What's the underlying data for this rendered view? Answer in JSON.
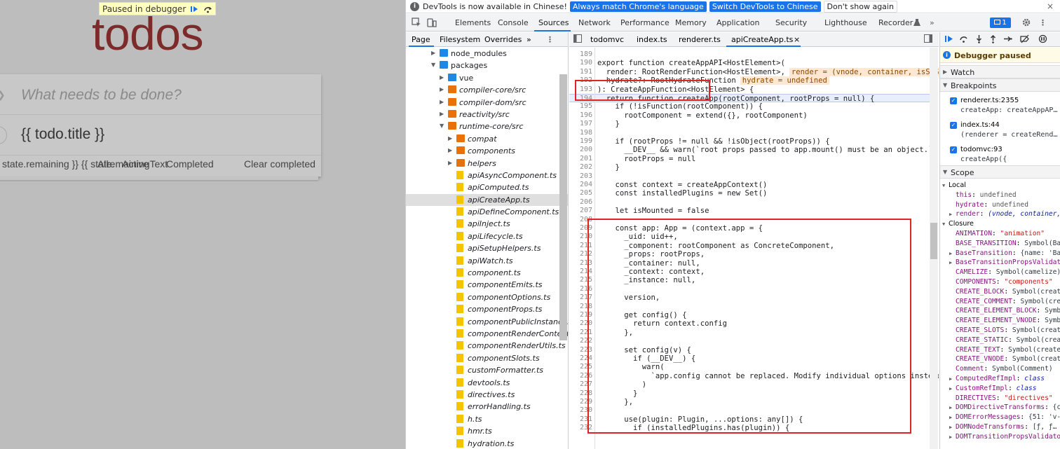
{
  "app": {
    "paused_label": "Paused in debugger",
    "title": "todos",
    "new_todo_placeholder": "What needs to be done?",
    "toggle_all": "❯",
    "todo_item_label": "{{ todo.title }}",
    "footer": {
      "remaining": "state.remaining }} {{ state.",
      "filter_all": "All",
      "filter_active": "Active",
      "remaining_text": "remainingText",
      "pluralize": "}}",
      "filter_completed": "Completed",
      "clear_completed": "Clear completed"
    }
  },
  "infobar": {
    "message": "DevTools is now available in Chinese!",
    "btn_match": "Always match Chrome's language",
    "btn_switch": "Switch DevTools to Chinese",
    "btn_dismiss": "Don't show again",
    "close": "×"
  },
  "tabs": {
    "elements": "Elements",
    "console": "Console",
    "sources": "Sources",
    "network": "Network",
    "performance": "Performance",
    "memory": "Memory",
    "application": "Application",
    "security": "Security",
    "lighthouse": "Lighthouse",
    "recorder": "Recorder",
    "issues_count": "1"
  },
  "navigator": {
    "tabs": [
      "Page",
      "Filesystem",
      "Overrides",
      "»"
    ],
    "items": [
      {
        "label": "node_modules",
        "type": "folder-blue",
        "arrow": "▶",
        "indent": 1
      },
      {
        "label": "packages",
        "type": "folder-blue",
        "arrow": "▼",
        "indent": 1
      },
      {
        "label": "vue",
        "type": "folder-blue",
        "arrow": "▶",
        "indent": 2
      },
      {
        "label": "compiler-core/src",
        "type": "folder-orange",
        "arrow": "▶",
        "indent": 2
      },
      {
        "label": "compiler-dom/src",
        "type": "folder-orange",
        "arrow": "▶",
        "indent": 2
      },
      {
        "label": "reactivity/src",
        "type": "folder-orange",
        "arrow": "▶",
        "indent": 2
      },
      {
        "label": "runtime-core/src",
        "type": "folder-orange",
        "arrow": "▼",
        "indent": 2
      },
      {
        "label": "compat",
        "type": "folder-orange",
        "arrow": "▶",
        "indent": 3
      },
      {
        "label": "components",
        "type": "folder-orange",
        "arrow": "▶",
        "indent": 3
      },
      {
        "label": "helpers",
        "type": "folder-orange",
        "arrow": "▶",
        "indent": 3
      },
      {
        "label": "apiAsyncComponent.ts",
        "type": "file",
        "arrow": "",
        "indent": 3
      },
      {
        "label": "apiComputed.ts",
        "type": "file",
        "arrow": "",
        "indent": 3
      },
      {
        "label": "apiCreateApp.ts",
        "type": "file",
        "arrow": "",
        "indent": 3,
        "selected": true
      },
      {
        "label": "apiDefineComponent.ts",
        "type": "file",
        "arrow": "",
        "indent": 3
      },
      {
        "label": "apiInject.ts",
        "type": "file",
        "arrow": "",
        "indent": 3
      },
      {
        "label": "apiLifecycle.ts",
        "type": "file",
        "arrow": "",
        "indent": 3
      },
      {
        "label": "apiSetupHelpers.ts",
        "type": "file",
        "arrow": "",
        "indent": 3
      },
      {
        "label": "apiWatch.ts",
        "type": "file",
        "arrow": "",
        "indent": 3
      },
      {
        "label": "component.ts",
        "type": "file",
        "arrow": "",
        "indent": 3
      },
      {
        "label": "componentEmits.ts",
        "type": "file",
        "arrow": "",
        "indent": 3
      },
      {
        "label": "componentOptions.ts",
        "type": "file",
        "arrow": "",
        "indent": 3
      },
      {
        "label": "componentProps.ts",
        "type": "file",
        "arrow": "",
        "indent": 3
      },
      {
        "label": "componentPublicInstance.ts",
        "type": "file",
        "arrow": "",
        "indent": 3
      },
      {
        "label": "componentRenderContext.ts",
        "type": "file",
        "arrow": "",
        "indent": 3
      },
      {
        "label": "componentRenderUtils.ts",
        "type": "file",
        "arrow": "",
        "indent": 3
      },
      {
        "label": "componentSlots.ts",
        "type": "file",
        "arrow": "",
        "indent": 3
      },
      {
        "label": "customFormatter.ts",
        "type": "file",
        "arrow": "",
        "indent": 3
      },
      {
        "label": "devtools.ts",
        "type": "file",
        "arrow": "",
        "indent": 3
      },
      {
        "label": "directives.ts",
        "type": "file",
        "arrow": "",
        "indent": 3
      },
      {
        "label": "errorHandling.ts",
        "type": "file",
        "arrow": "",
        "indent": 3
      },
      {
        "label": "h.ts",
        "type": "file",
        "arrow": "",
        "indent": 3
      },
      {
        "label": "hmr.ts",
        "type": "file",
        "arrow": "",
        "indent": 3
      },
      {
        "label": "hydration.ts",
        "type": "file",
        "arrow": "",
        "indent": 3
      }
    ]
  },
  "editor": {
    "tabs": [
      "todomvc",
      "index.ts",
      "renderer.ts",
      "apiCreateApp.ts"
    ],
    "tab_close": "×",
    "lines": [
      {
        "n": "189",
        "text": ""
      },
      {
        "n": "190",
        "text": "export function createAppAPI<HostElement>("
      },
      {
        "n": "191",
        "text": "  render: RootRenderFunction<HostElement>,",
        "inline": "render = (vnode, container, isSVG) =>"
      },
      {
        "n": "192",
        "text": "  hydrate?: RootHydrateFunction",
        "inline": "hydrate = undefined"
      },
      {
        "n": "193",
        "text": "): CreateAppFunction<HostElement> {"
      },
      {
        "n": "194",
        "text": "  return function createApp(rootComponent, rootProps = null) {",
        "hl": true
      },
      {
        "n": "195",
        "text": "    if (!isFunction(rootComponent)) {"
      },
      {
        "n": "196",
        "text": "      rootComponent = extend({}, rootComponent)"
      },
      {
        "n": "197",
        "text": "    }"
      },
      {
        "n": "198",
        "text": ""
      },
      {
        "n": "199",
        "text": "    if (rootProps != null && !isObject(rootProps)) {"
      },
      {
        "n": "200",
        "text": "      __DEV__ && warn(`root props passed to app.mount() must be an object.`)"
      },
      {
        "n": "201",
        "text": "      rootProps = null"
      },
      {
        "n": "202",
        "text": "    }"
      },
      {
        "n": "203",
        "text": ""
      },
      {
        "n": "204",
        "text": "    const context = createAppContext()"
      },
      {
        "n": "205",
        "text": "    const installedPlugins = new Set()"
      },
      {
        "n": "206",
        "text": ""
      },
      {
        "n": "207",
        "text": "    let isMounted = false"
      },
      {
        "n": "208",
        "text": ""
      },
      {
        "n": "209",
        "text": "    const app: App = (context.app = {"
      },
      {
        "n": "210",
        "text": "      _uid: uid++,"
      },
      {
        "n": "211",
        "text": "      _component: rootComponent as ConcreteComponent,"
      },
      {
        "n": "212",
        "text": "      _props: rootProps,"
      },
      {
        "n": "213",
        "text": "      _container: null,"
      },
      {
        "n": "214",
        "text": "      _context: context,"
      },
      {
        "n": "215",
        "text": "      _instance: null,"
      },
      {
        "n": "216",
        "text": ""
      },
      {
        "n": "217",
        "text": "      version,"
      },
      {
        "n": "218",
        "text": ""
      },
      {
        "n": "219",
        "text": "      get config() {"
      },
      {
        "n": "220",
        "text": "        return context.config"
      },
      {
        "n": "221",
        "text": "      },"
      },
      {
        "n": "222",
        "text": ""
      },
      {
        "n": "223",
        "text": "      set config(v) {"
      },
      {
        "n": "224",
        "text": "        if (__DEV__) {"
      },
      {
        "n": "225",
        "text": "          warn("
      },
      {
        "n": "226",
        "text": "            `app.config cannot be replaced. Modify individual options instead.`"
      },
      {
        "n": "227",
        "text": "          )"
      },
      {
        "n": "228",
        "text": "        }"
      },
      {
        "n": "229",
        "text": "      },"
      },
      {
        "n": "230",
        "text": ""
      },
      {
        "n": "231",
        "text": "      use(plugin: Plugin, ...options: any[]) {"
      },
      {
        "n": "232",
        "text": "        if (installedPlugins.has(plugin)) {"
      }
    ]
  },
  "debugger": {
    "paused": "Debugger paused",
    "watch": "Watch",
    "breakpoints_title": "Breakpoints",
    "breakpoints": [
      {
        "file": "renderer.ts:2355",
        "code": "createApp: createAppAP…"
      },
      {
        "file": "index.ts:44",
        "code": "(renderer = createRend…"
      },
      {
        "file": "todomvc:93",
        "code": "createApp({"
      }
    ],
    "scope_title": "Scope",
    "scope": [
      {
        "indent": 0,
        "arrow": "▼",
        "key": "Local",
        "sep": "",
        "val": "",
        "kind": "head"
      },
      {
        "indent": 1,
        "arrow": "",
        "key": "this",
        "sep": ": ",
        "val": "undefined",
        "kind": "g"
      },
      {
        "indent": 1,
        "arrow": "",
        "key": "hydrate",
        "sep": ": ",
        "val": "undefined",
        "kind": "g"
      },
      {
        "indent": 1,
        "arrow": "▶",
        "key": "render",
        "sep": ": ",
        "val": "(vnode, container, …",
        "kind": "i"
      },
      {
        "indent": 0,
        "arrow": "▼",
        "key": "Closure",
        "sep": "",
        "val": "",
        "kind": "head"
      },
      {
        "indent": 1,
        "arrow": "",
        "key": "ANIMATION",
        "sep": ": ",
        "val": "\"animation\"",
        "kind": "s"
      },
      {
        "indent": 1,
        "arrow": "",
        "key": "BASE_TRANSITION",
        "sep": ": ",
        "val": "Symbol(Bas…",
        "kind": "o"
      },
      {
        "indent": 1,
        "arrow": "▶",
        "key": "BaseTransition",
        "sep": ": ",
        "val": "{name: 'Bas…",
        "kind": "o"
      },
      {
        "indent": 1,
        "arrow": "▶",
        "key": "BaseTransitionPropsValidato…",
        "sep": "",
        "val": "",
        "kind": "o"
      },
      {
        "indent": 1,
        "arrow": "",
        "key": "CAMELIZE",
        "sep": ": ",
        "val": "Symbol(camelize)",
        "kind": "o"
      },
      {
        "indent": 1,
        "arrow": "",
        "key": "COMPONENTS",
        "sep": ": ",
        "val": "\"components\"",
        "kind": "s"
      },
      {
        "indent": 1,
        "arrow": "",
        "key": "CREATE_BLOCK",
        "sep": ": ",
        "val": "Symbol(create…",
        "kind": "o"
      },
      {
        "indent": 1,
        "arrow": "",
        "key": "CREATE_COMMENT",
        "sep": ": ",
        "val": "Symbol(crea…",
        "kind": "o"
      },
      {
        "indent": 1,
        "arrow": "",
        "key": "CREATE_ELEMENT_BLOCK",
        "sep": ": ",
        "val": "Symbo…",
        "kind": "o"
      },
      {
        "indent": 1,
        "arrow": "",
        "key": "CREATE_ELEMENT_VNODE",
        "sep": ": ",
        "val": "Symbo…",
        "kind": "o"
      },
      {
        "indent": 1,
        "arrow": "",
        "key": "CREATE_SLOTS",
        "sep": ": ",
        "val": "Symbol(create…",
        "kind": "o"
      },
      {
        "indent": 1,
        "arrow": "",
        "key": "CREATE_STATIC",
        "sep": ": ",
        "val": "Symbol(creat…",
        "kind": "o"
      },
      {
        "indent": 1,
        "arrow": "",
        "key": "CREATE_TEXT",
        "sep": ": ",
        "val": "Symbol(create…",
        "kind": "o"
      },
      {
        "indent": 1,
        "arrow": "",
        "key": "CREATE_VNODE",
        "sep": ": ",
        "val": "Symbol(create…",
        "kind": "o"
      },
      {
        "indent": 1,
        "arrow": "",
        "key": "Comment",
        "sep": ": ",
        "val": "Symbol(Comment)",
        "kind": "o"
      },
      {
        "indent": 1,
        "arrow": "▶",
        "key": "ComputedRefImpl",
        "sep": ": ",
        "val": "class",
        "kind": "i"
      },
      {
        "indent": 1,
        "arrow": "▶",
        "key": "CustomRefImpl",
        "sep": ": ",
        "val": "class",
        "kind": "i"
      },
      {
        "indent": 1,
        "arrow": "",
        "key": "DIRECTIVES",
        "sep": ": ",
        "val": "\"directives\"",
        "kind": "s"
      },
      {
        "indent": 1,
        "arrow": "▶",
        "key": "DOMDirectiveTransforms",
        "sep": ": ",
        "val": "{cl…",
        "kind": "o"
      },
      {
        "indent": 1,
        "arrow": "▶",
        "key": "DOMErrorMessages",
        "sep": ": ",
        "val": "{51: 'v-h…",
        "kind": "o"
      },
      {
        "indent": 1,
        "arrow": "▶",
        "key": "DOMNodeTransforms",
        "sep": ": ",
        "val": "[ƒ, ƒ…",
        "kind": "o"
      },
      {
        "indent": 1,
        "arrow": "▶",
        "key": "DOMTransitionPropsValidator…",
        "sep": "",
        "val": "",
        "kind": "o"
      }
    ]
  },
  "colors": {
    "accent": "#1a73e8",
    "highlight_box": "#e02424",
    "todos_title": "#7d2a2a"
  }
}
